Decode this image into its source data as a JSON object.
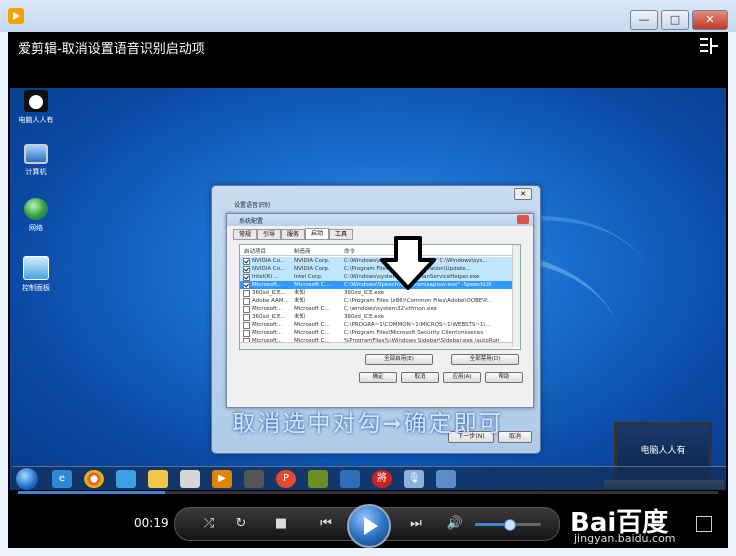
{
  "window": {
    "minimize": "—",
    "maximize": "□",
    "close": "✕"
  },
  "player": {
    "title": "爱剪辑-取消设置语音识别启动项",
    "time": "00:19",
    "progress_fraction": 0.21,
    "volume_fraction": 0.5
  },
  "desktop": {
    "icons": [
      {
        "label": "电脑人人有",
        "icon": "panda-icon"
      },
      {
        "label": "计算机",
        "icon": "computer-icon"
      },
      {
        "label": "网络",
        "icon": "network-icon"
      },
      {
        "label": "控制面板",
        "icon": "control-panel-icon"
      }
    ]
  },
  "dialog_outer": {
    "title": "设置语音识别",
    "next_button": "下一步(N)",
    "cancel_button": "取消"
  },
  "msconfig": {
    "title": "系统配置",
    "tabs": [
      "常规",
      "引导",
      "服务",
      "启动",
      "工具"
    ],
    "selected_tab": "启动",
    "columns": [
      "启动项目",
      "制造商",
      "命令"
    ],
    "rows": [
      {
        "checked": true,
        "item": "NVIDIA Co...",
        "maker": "NVIDIA Corp.",
        "cmd": "C:\\Windows\\system32\\nvtray.exe\" C:\\Windows\\sys..."
      },
      {
        "checked": true,
        "item": "NVIDIA Co...",
        "maker": "NVIDIA Corp.",
        "cmd": "C:\\Program Files\\NVIDIA Corporation\\Update..."
      },
      {
        "checked": true,
        "item": "Intel(R) ...",
        "maker": "Intel Corp.",
        "cmd": "C:\\Windows\\system32\\OptiPlanServiceHelper.exe"
      },
      {
        "checked": true,
        "item": "Microsoft...",
        "maker": "Microsoft C...",
        "cmd": "C:\\Windows\\Speech\\Common\\sapisvr.exe\" -SpeechUX"
      },
      {
        "checked": false,
        "item": "360sd_ICE...",
        "maker": "未知",
        "cmd": "360sd_ICE.exe"
      },
      {
        "checked": false,
        "item": "Adobe AAM...",
        "maker": "未知",
        "cmd": "C:\\Program Files (x86)\\Common Files\\Adobe\\OOBE\\P..."
      },
      {
        "checked": false,
        "item": "Microsoft...",
        "maker": "Microsoft C...",
        "cmd": "C:\\windows\\system32\\ctfmon.exe"
      },
      {
        "checked": false,
        "item": "360sd_ICE...",
        "maker": "未知",
        "cmd": "360sd_ICE.exe"
      },
      {
        "checked": false,
        "item": "Microsoft...",
        "maker": "Microsoft C...",
        "cmd": "C:\\PROGRA~1\\COMMON~1\\MICROS~1\\WEBSTS~1\\..."
      },
      {
        "checked": false,
        "item": "Microsoft...",
        "maker": "Microsoft C...",
        "cmd": "C:\\Program Files\\Microsoft Security Client\\msseces"
      },
      {
        "checked": false,
        "item": "Microsoft...",
        "maker": "Microsoft C...",
        "cmd": "%ProgramFiles%\\Windows Sidebar\\Sidebar.exe /autoRun"
      }
    ],
    "enable_all": "全部启用(E)",
    "disable_all": "全部禁用(D)",
    "ok": "确定",
    "cancel": "取消",
    "apply": "应用(A)",
    "help": "帮助"
  },
  "caption": "取消选中对勾➞确定即可",
  "laptop_text": "电脑人人有",
  "watermark": {
    "logo": "Bai百度",
    "url": "jingyan.baidu.com"
  },
  "colors": {
    "accent": "#3d86d6",
    "selected_row": "#3399ff",
    "highlight_row": "#bfe6ff"
  }
}
